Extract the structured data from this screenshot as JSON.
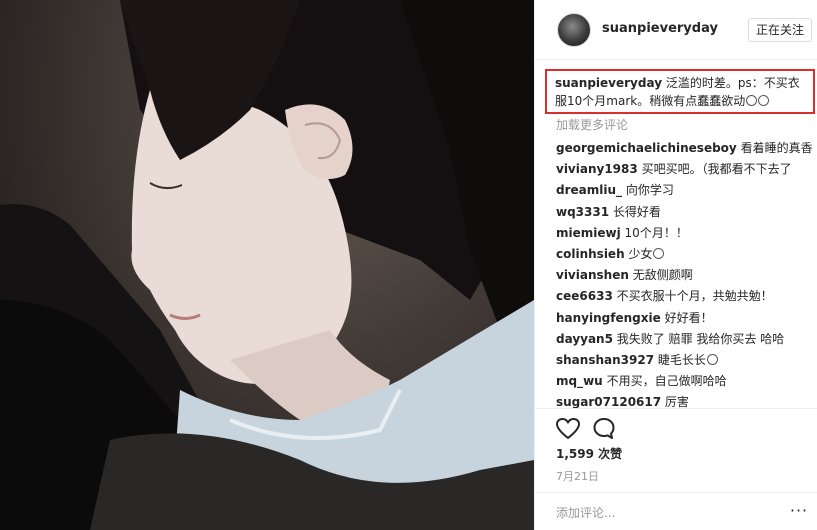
{
  "post": {
    "username": "suanpieveryday",
    "follow_label": "正在关注",
    "caption_user": "suanpieveryday",
    "caption_text": "泛滥的时差。ps：不买衣服10个月mark。稍微有点蠢蠢欲动",
    "caption_emoji": [
      "smile",
      "smile"
    ],
    "load_more": "加载更多评论",
    "likes": "1,599 次赞",
    "date": "7月21日",
    "add_comment_placeholder": "添加评论...",
    "more_label": "···"
  },
  "comments": [
    {
      "user": "georgemichaelichineseboy",
      "text": "看着睡的真香"
    },
    {
      "user": "viviany1983",
      "text": "买吧买吧。（我都看不下去了"
    },
    {
      "user": "dreamliu_",
      "text": "向你学习"
    },
    {
      "user": "wq3331",
      "text": "长得好看"
    },
    {
      "user": "miemiewj",
      "text": "10个月！！"
    },
    {
      "user": "colinhsieh",
      "text": "少女"
    },
    {
      "user": "vivianshen",
      "text": "无敌侧颜啊"
    },
    {
      "user": "cee6633",
      "text": "不买衣服十个月，共勉共勉！"
    },
    {
      "user": "hanyingfengxie",
      "text": "好好看！"
    },
    {
      "user": "dayyan5",
      "text": "我失败了 赔罪 我给你买去 哈哈"
    },
    {
      "user": "shanshan3927",
      "text": "睫毛长长"
    },
    {
      "user": "mq_wu",
      "text": "不用买，自己做啊哈哈"
    },
    {
      "user": "sugar07120617",
      "text": "厉害"
    }
  ],
  "icons": {
    "like": "heart-icon",
    "comment": "comment-bubble-icon",
    "emoji": "smiley-icon"
  },
  "colors": {
    "highlight_border": "#d9302b",
    "muted_text": "#999999",
    "text": "#262626"
  }
}
